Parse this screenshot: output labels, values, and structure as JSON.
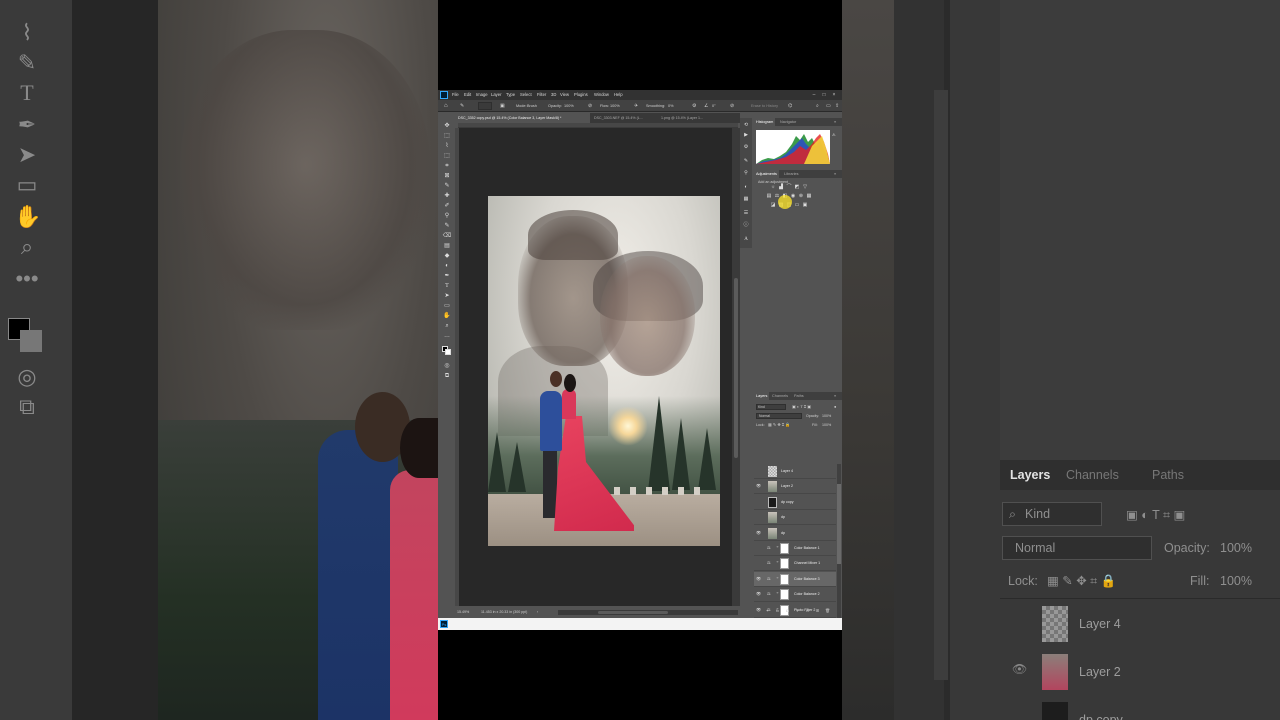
{
  "menubar": {
    "app_icon": "Ps",
    "items": [
      "File",
      "Edit",
      "Image",
      "Layer",
      "Type",
      "Select",
      "Filter",
      "3D",
      "View",
      "Plugins",
      "Window",
      "Help"
    ],
    "window_buttons": [
      "–",
      "□",
      "×"
    ]
  },
  "options": {
    "mode_label": "Mode:",
    "mode_value": "Brush",
    "opacity_label": "Opacity:",
    "opacity_value": "100%",
    "flow_label": "Flow:",
    "flow_value": "100%",
    "smoothing_label": "Smoothing:",
    "smoothing_value": "0%",
    "angle_value": "0°",
    "erase_label": "Erase to History"
  },
  "doc_tabs": [
    "DSC_3352 copy.psd @ 15.4% (Color Balance 3, Layer Mask/8) *",
    "DSC_3303.NEF @ 15.4% (L...",
    "1.png @ 15.4% (Layer 1..."
  ],
  "status": {
    "zoom": "15.49%",
    "size": "11.453 in x 20.33 in (300 ppi)"
  },
  "panels": {
    "histogram_tab": "Histogram",
    "navigator_tab": "Navigator",
    "adjustments_tab": "Adjustments",
    "libraries_tab": "Libraries",
    "add_adjustment": "Add an adjustment",
    "layers_tab": "Layers",
    "channels_tab": "Channels",
    "paths_tab": "Paths"
  },
  "layers_controls": {
    "kind": "Kind",
    "blend": "Normal",
    "opacity_label": "Opacity:",
    "opacity": "100%",
    "lock_label": "Lock:",
    "fill_label": "Fill:",
    "fill": "100%"
  },
  "layers": [
    {
      "name": "Layer 4",
      "visible": false,
      "kind": "transparent",
      "selected": false
    },
    {
      "name": "Layer 2",
      "visible": true,
      "kind": "photo",
      "selected": false
    },
    {
      "name": "dp copy",
      "visible": false,
      "kind": "dark",
      "selected": false
    },
    {
      "name": "dp",
      "visible": false,
      "kind": "photo",
      "selected": false
    },
    {
      "name": "dp",
      "visible": true,
      "kind": "photo",
      "selected": false
    },
    {
      "name": "Color Balance 1",
      "visible": false,
      "kind": "adjustment",
      "selected": false
    },
    {
      "name": "Channel Mixer 1",
      "visible": false,
      "kind": "adjustment",
      "selected": false
    },
    {
      "name": "Color Balance 3",
      "visible": true,
      "kind": "adjustment",
      "selected": true
    },
    {
      "name": "Color Balance 2",
      "visible": true,
      "kind": "adjustment",
      "selected": false
    },
    {
      "name": "Photo Filter 2",
      "visible": true,
      "kind": "adjustment",
      "selected": false
    },
    {
      "name": "Photo Filter 1",
      "visible": false,
      "kind": "adjustment",
      "selected": false
    }
  ],
  "bg_right": {
    "tabs": [
      "Layers",
      "Channels",
      "Paths"
    ],
    "kind": "Kind",
    "blend": "Normal",
    "opacity_label": "Opacity:",
    "opacity": "100%",
    "lock_label": "Lock:",
    "fill_label": "Fill:",
    "fill": "100%",
    "layers": [
      "Layer 4",
      "Layer 2",
      "dp copy"
    ]
  },
  "icons": {
    "left_bg_tools": [
      "lasso-icon",
      "spot-heal-icon",
      "type-icon",
      "pen-icon",
      "select-arrow-icon",
      "rectangle-icon",
      "hand-icon",
      "zoom-icon",
      "more-icon"
    ]
  }
}
